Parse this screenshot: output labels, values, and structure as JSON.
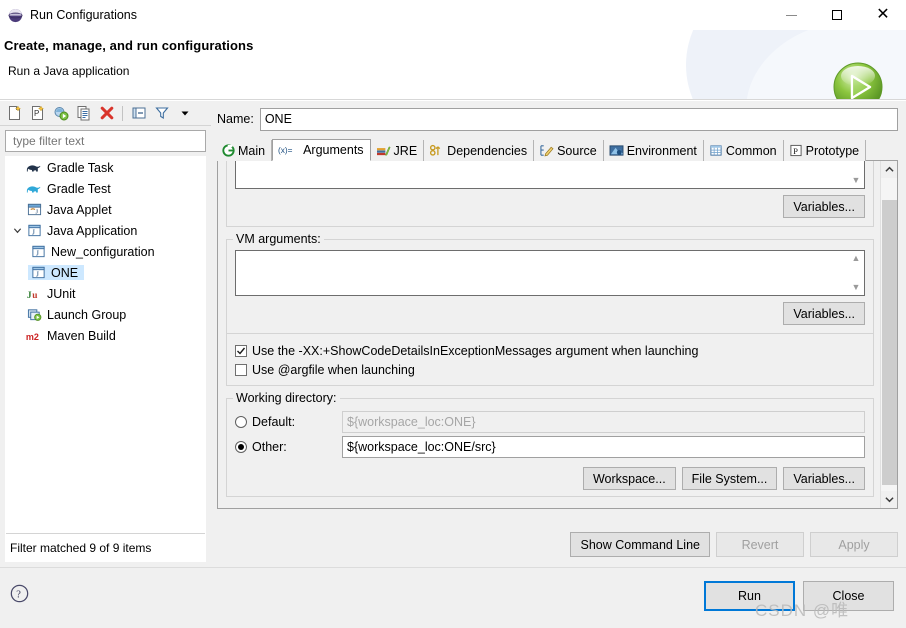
{
  "window": {
    "title": "Run Configurations",
    "icon": "eclipse-globe-icon",
    "minimize_label": "—",
    "maximize_label": "□",
    "close_label": "✕"
  },
  "banner": {
    "heading": "Create, manage, and run configurations",
    "subheading": "Run a Java application",
    "badge_icon": "green-run-play-icon"
  },
  "left_pane": {
    "toolbar": [
      {
        "name": "new-launch-configuration-icon",
        "tooltip": "New launch configuration"
      },
      {
        "name": "new-prototype-icon",
        "tooltip": "New prototype"
      },
      {
        "name": "export-launch-configuration-icon",
        "tooltip": "Export"
      },
      {
        "name": "duplicate-icon",
        "tooltip": "Duplicate"
      },
      {
        "name": "delete-icon",
        "tooltip": "Delete"
      },
      {
        "name": "collapse-all-icon",
        "tooltip": "Collapse All"
      },
      {
        "name": "filter-icon",
        "tooltip": "Filter launch configurations"
      },
      {
        "name": "view-menu-chevron-icon",
        "tooltip": "View Menu"
      }
    ],
    "filter": {
      "placeholder": "type filter text",
      "value": ""
    },
    "tree": [
      {
        "label": "Gradle Task",
        "icon": "gradle-elephant-dark-icon",
        "level": 0,
        "expander": "",
        "selected": false
      },
      {
        "label": "Gradle Test",
        "icon": "gradle-elephant-light-icon",
        "level": 0,
        "expander": "",
        "selected": false
      },
      {
        "label": "Java Applet",
        "icon": "java-applet-icon",
        "level": 0,
        "expander": "",
        "selected": false
      },
      {
        "label": "Java Application",
        "icon": "java-application-icon",
        "level": 0,
        "expander": "expanded",
        "selected": false
      },
      {
        "label": "New_configuration",
        "icon": "java-application-icon",
        "level": 1,
        "expander": "",
        "selected": false
      },
      {
        "label": "ONE",
        "icon": "java-application-icon",
        "level": 1,
        "expander": "",
        "selected": true
      },
      {
        "label": "JUnit",
        "icon": "junit-icon",
        "level": 0,
        "expander": "",
        "selected": false
      },
      {
        "label": "Launch Group",
        "icon": "launch-group-icon",
        "level": 0,
        "expander": "",
        "selected": false
      },
      {
        "label": "Maven Build",
        "icon": "maven-m2-icon",
        "level": 0,
        "expander": "",
        "selected": false
      }
    ],
    "status": "Filter matched 9 of 9 items"
  },
  "right_pane": {
    "name_label": "Name:",
    "name_value": "ONE",
    "tabs": [
      {
        "label": "Main",
        "icon": "main-green-circle-icon",
        "active": false
      },
      {
        "label": "Arguments",
        "icon": "arguments-xe-icon",
        "active": true
      },
      {
        "label": "JRE",
        "icon": "jre-books-icon",
        "active": false
      },
      {
        "label": "Dependencies",
        "icon": "dependencies-link-icon",
        "active": false
      },
      {
        "label": "Source",
        "icon": "source-pencil-icon",
        "active": false
      },
      {
        "label": "Environment",
        "icon": "environment-monitor-icon",
        "active": false
      },
      {
        "label": "Common",
        "icon": "common-table-icon",
        "active": false
      },
      {
        "label": "Prototype",
        "icon": "prototype-p-icon",
        "active": false
      }
    ],
    "program_arguments": {
      "value": "",
      "variables_button": "Variables..."
    },
    "vm_arguments": {
      "label": "VM arguments:",
      "value": "",
      "variables_button": "Variables..."
    },
    "checkboxes": [
      {
        "label": "Use the -XX:+ShowCodeDetailsInExceptionMessages argument when launching",
        "checked": true
      },
      {
        "label": "Use @argfile when launching",
        "checked": false
      }
    ],
    "working_directory": {
      "label": "Working directory:",
      "default_radio_label": "Default:",
      "default_value": "${workspace_loc:ONE}",
      "default_selected": false,
      "other_radio_label": "Other:",
      "other_value": "${workspace_loc:ONE/src}",
      "other_selected": true,
      "buttons": [
        "Workspace...",
        "File System...",
        "Variables..."
      ]
    },
    "actions": [
      {
        "label": "Show Command Line",
        "enabled": true
      },
      {
        "label": "Revert",
        "enabled": false
      },
      {
        "label": "Apply",
        "enabled": false
      }
    ]
  },
  "footer": {
    "help_icon": "help-question-icon",
    "buttons": [
      {
        "label": "Run",
        "primary": true
      },
      {
        "label": "Close",
        "primary": false
      }
    ]
  },
  "watermark": "CSDN @唯"
}
